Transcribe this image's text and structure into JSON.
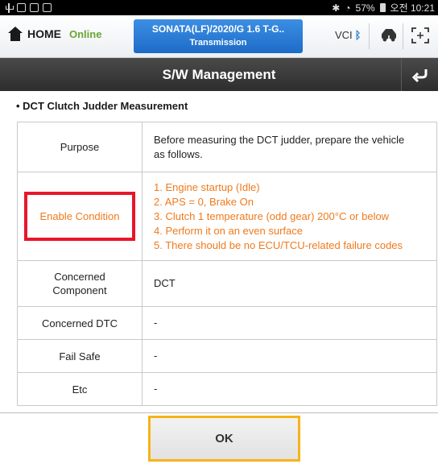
{
  "status_bar": {
    "battery": "57%",
    "time": "오전 10:21"
  },
  "header": {
    "home_label": "HOME",
    "connection_status": "Online",
    "vehicle_title": "SONATA(LF)/2020/G 1.6 T-G..",
    "vehicle_subtitle": "Transmission",
    "vci_label": "VCI"
  },
  "titlebar": {
    "title": "S/W Management"
  },
  "section": {
    "heading": "• DCT Clutch Judder Measurement"
  },
  "table": {
    "purpose_label": "Purpose",
    "purpose_value_line1": "Before measuring the DCT judder, prepare the vehicle",
    "purpose_value_line2": "as follows.",
    "enable_label": "Enable Condition",
    "enable_items": [
      "1. Engine startup (Idle)",
      "2. APS = 0, Brake On",
      "3. Clutch 1 temperature (odd gear) 200°C or below",
      "4. Perform it on an even surface",
      "5. There should be no ECU/TCU-related failure codes"
    ],
    "component_label_line1": "Concerned",
    "component_label_line2": "Component",
    "component_value": "DCT",
    "dtc_label": "Concerned DTC",
    "dtc_value": "-",
    "failsafe_label": "Fail Safe",
    "failsafe_value": "-",
    "etc_label": "Etc",
    "etc_value": "-"
  },
  "footer": {
    "ok_label": "OK"
  },
  "colors": {
    "accent_orange": "#f07a1c",
    "highlight_red": "#e8162a",
    "highlight_yellow": "#f7b318",
    "online_green": "#6aa632",
    "vehicle_blue": "#1d6bc8"
  },
  "icons": {
    "status_left": [
      "usb-icon",
      "gallery-icon",
      "message-icon",
      "app-icon"
    ],
    "status_right": [
      "bluetooth-icon",
      "wifi-icon",
      "battery-icon"
    ],
    "header": [
      "home-icon",
      "bluetooth-icon",
      "vehicle-connect-icon",
      "fullscreen-icon"
    ],
    "titlebar": [
      "back-arrow-icon"
    ]
  }
}
